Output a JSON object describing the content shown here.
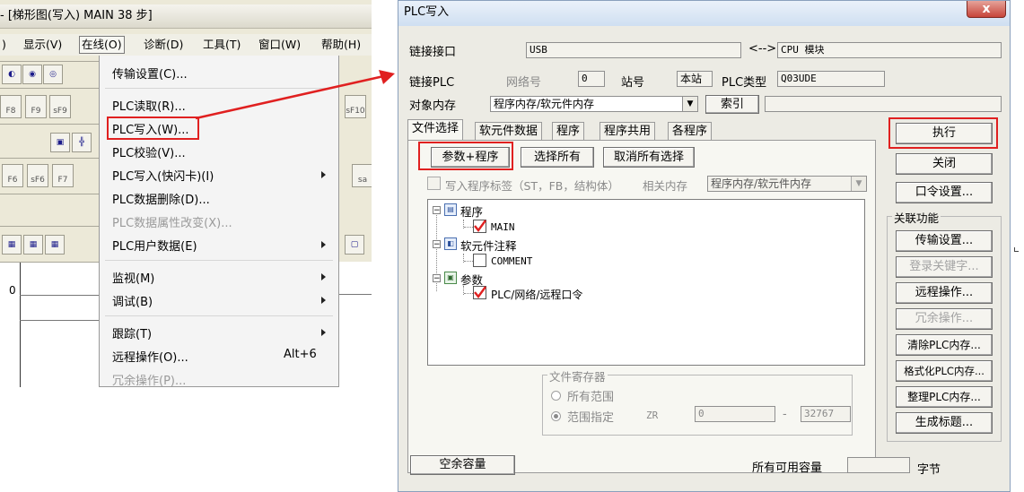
{
  "left_window": {
    "title": "- [梯形图(写入)    MAIN   38 步]",
    "menubar": [
      {
        "label": ")"
      },
      {
        "label": "显示(V)"
      },
      {
        "label": "在线(O)"
      },
      {
        "label": "诊断(D)"
      },
      {
        "label": "工具(T)"
      },
      {
        "label": "窗口(W)"
      },
      {
        "label": "帮助(H)"
      }
    ],
    "fkeys": {
      "f8": "F8",
      "f9": "F9",
      "sf9": "sF9",
      "f6": "F6",
      "sf6": "sF6",
      "f7": "F7",
      "sf10": "sF10",
      "sa": "sa"
    },
    "ladder_row_number": "0",
    "dropdown": {
      "items": [
        {
          "label": "传输设置(C)..."
        },
        {
          "label": "PLC读取(R)..."
        },
        {
          "label": "PLC写入(W)...",
          "highlighted": true
        },
        {
          "label": "PLC校验(V)..."
        },
        {
          "label": "PLC写入(快闪卡)(I)",
          "submenu": true
        },
        {
          "label": "PLC数据删除(D)..."
        },
        {
          "label": "PLC数据属性改变(X)...",
          "disabled": true
        },
        {
          "label": "PLC用户数据(E)",
          "submenu": true
        },
        {
          "label": "监视(M)",
          "submenu": true
        },
        {
          "label": "调试(B)",
          "submenu": true
        },
        {
          "label": "跟踪(T)",
          "submenu": true
        },
        {
          "label": "远程操作(O)...",
          "shortcut": "Alt+6"
        },
        {
          "label": "冗余操作(P)...",
          "disabled": true
        }
      ]
    }
  },
  "annotation_color": "#e02020",
  "dialog": {
    "title": "PLC写入",
    "close_glyph": "x",
    "link_interface_label": "链接接口",
    "link_interface_value": "USB",
    "link_arrow": "<-->",
    "link_target_value": "CPU 模块",
    "link_plc_label": "链接PLC",
    "network_no_label": "网络号",
    "network_no_value": "0",
    "station_label": "站号",
    "station_value": "本站",
    "plc_type_label": "PLC类型",
    "plc_type_value": "Q03UDE",
    "target_memory_label": "对象内存",
    "target_memory_value": "程序内存/软元件内存",
    "index_button": "索引",
    "index_value": "",
    "tabs": [
      "文件选择",
      "软元件数据",
      "程序",
      "程序共用",
      "各程序"
    ],
    "btn_param_program": "参数+程序",
    "btn_select_all": "选择所有",
    "btn_deselect_all": "取消所有选择",
    "write_label_checkbox": "写入程序标签（ST，FB，结构体）",
    "related_memory_label": "相关内存",
    "related_memory_value": "程序内存/软元件内存",
    "tree": {
      "program": "程序",
      "main": "MAIN",
      "device_comment": "软元件注释",
      "comment": "COMMENT",
      "parameter": "参数",
      "plc_network": "PLC/网络/远程口令"
    },
    "file_register": {
      "legend": "文件寄存器",
      "all_range": "所有范围",
      "range_specified": "范围指定",
      "zr": "ZR",
      "from": "0",
      "dash": "-",
      "to": "32767"
    },
    "free_space_button": "空余容量",
    "all_free_capacity_label": "所有可用容量",
    "capacity_value": "",
    "bytes_label": "字节",
    "execute_button": "执行",
    "close_button": "关闭",
    "password_button": "口令设置...",
    "related_functions_legend": "关联功能",
    "side_buttons": [
      {
        "label": "传输设置...",
        "disabled": false
      },
      {
        "label": "登录关键字...",
        "disabled": true
      },
      {
        "label": "远程操作...",
        "disabled": false
      },
      {
        "label": "冗余操作...",
        "disabled": true
      },
      {
        "label": "清除PLC内存...",
        "disabled": false
      },
      {
        "label": "格式化PLC内存...",
        "disabled": false
      },
      {
        "label": "整理PLC内存...",
        "disabled": false
      },
      {
        "label": "生成标题...",
        "disabled": false
      }
    ]
  }
}
